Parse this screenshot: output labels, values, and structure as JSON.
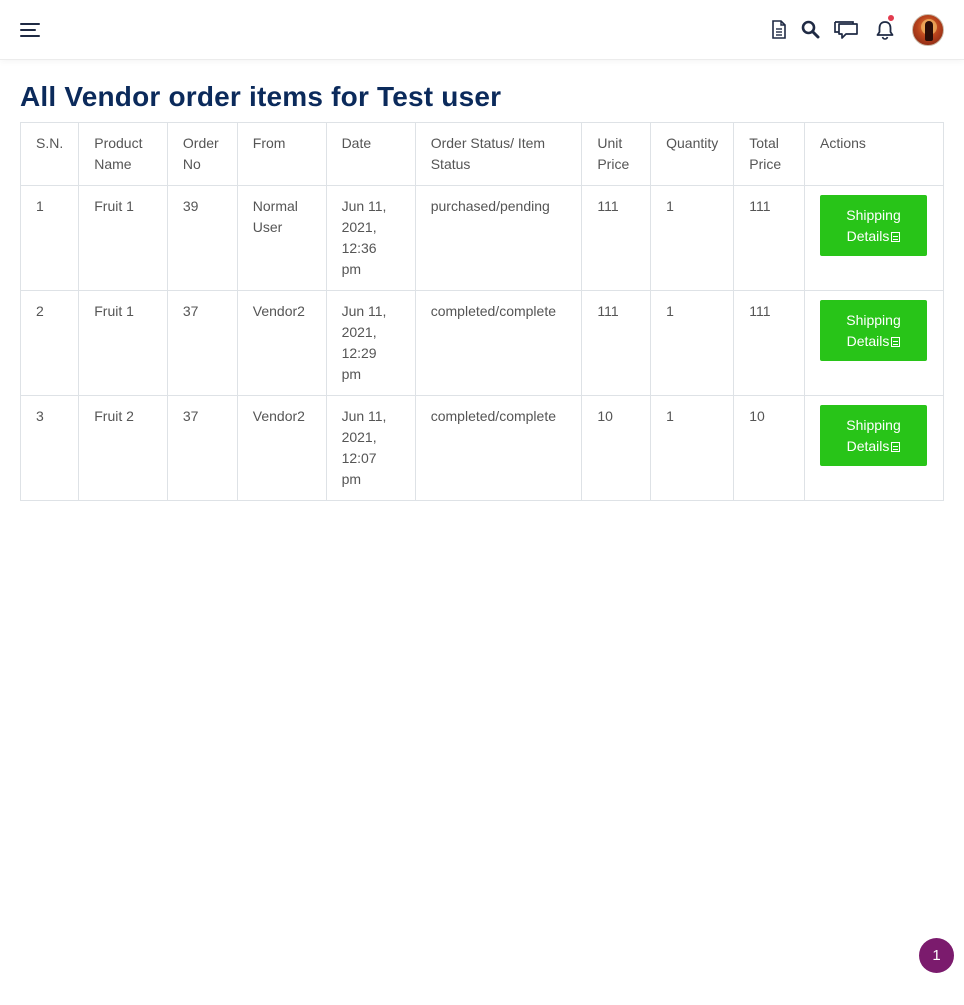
{
  "page_title": "All Vendor order items for Test user",
  "table": {
    "headers": {
      "sn": "S.N.",
      "product_name": "Product Name",
      "order_no": "Order No",
      "from": "From",
      "date": "Date",
      "status": "Order Status/ Item Status",
      "unit_price": "Unit Price",
      "quantity": "Quantity",
      "total_price": "Total Price",
      "actions": "Actions"
    },
    "rows": [
      {
        "sn": "1",
        "product": "Fruit 1",
        "order_no": "39",
        "from": "Normal User",
        "date": "Jun 11, 2021, 12:36 pm",
        "status": "purchased/pending",
        "unit_price": "111",
        "quantity": "1",
        "total_price": "111",
        "action_label": "Shipping Details"
      },
      {
        "sn": "2",
        "product": "Fruit 1",
        "order_no": "37",
        "from": "Vendor2",
        "date": "Jun 11, 2021, 12:29 pm",
        "status": "completed/complete",
        "unit_price": "111",
        "quantity": "1",
        "total_price": "111",
        "action_label": "Shipping Details"
      },
      {
        "sn": "3",
        "product": "Fruit 2",
        "order_no": "37",
        "from": "Vendor2",
        "date": "Jun 11, 2021, 12:07 pm",
        "status": "completed/complete",
        "unit_price": "10",
        "quantity": "1",
        "total_price": "10",
        "action_label": "Shipping Details"
      }
    ]
  },
  "header_icons": [
    "menu-icon",
    "document-icon",
    "search-icon",
    "chat-icon",
    "bell-icon",
    "avatar"
  ],
  "page_badge": "1",
  "colors": {
    "title": "#0b2a5b",
    "action_button": "#28c418",
    "notification_dot": "#e23b4e",
    "page_badge": "#7b1b6d"
  }
}
